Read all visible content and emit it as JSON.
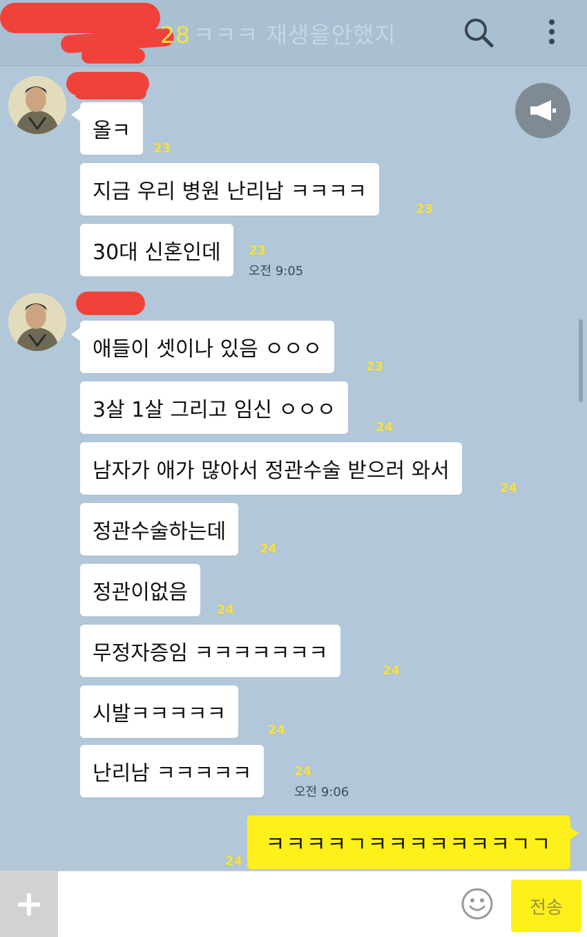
{
  "header": {
    "unread": "28",
    "title": "ㅋㅋㅋ 재생을안했지"
  },
  "messages_group1": [
    {
      "text": "올ㅋ",
      "count": "23"
    },
    {
      "text": "지금 우리 병원 난리남 ㅋㅋㅋㅋ",
      "count": "23"
    },
    {
      "text": "30대 신혼인데",
      "count": "23",
      "time": "오전 9:05"
    }
  ],
  "messages_group2": [
    {
      "text": "애들이 셋이나 있음 ㅇㅇㅇ",
      "count": "23"
    },
    {
      "text": "3살 1살 그리고 임신 ㅇㅇㅇ",
      "count": "24"
    },
    {
      "text": "남자가 애가 많아서 정관수술 받으러 와서",
      "count": "24"
    },
    {
      "text": "정관수술하는데",
      "count": "24"
    },
    {
      "text": "정관이없음",
      "count": "24"
    },
    {
      "text": "무정자증임 ㅋㅋㅋㅋㅋㅋㅋ",
      "count": "24"
    },
    {
      "text": "시발ㅋㅋㅋㅋㅋ",
      "count": "24"
    },
    {
      "text": "난리남 ㅋㅋㅋㅋㅋ",
      "count": "24",
      "time": "오전 9:06"
    }
  ],
  "my_message": {
    "text": "ㅋㅋㅋㅋㄱㅋㅋㅋㅋㅋㅋㅋㄱㄱ",
    "count": "24"
  },
  "input": {
    "placeholder": "",
    "send_label": "전송"
  },
  "icons": {
    "search": "search-icon",
    "menu": "more-vertical-icon",
    "notice": "megaphone-icon",
    "plus": "plus-icon",
    "emoji": "smiley-icon"
  }
}
